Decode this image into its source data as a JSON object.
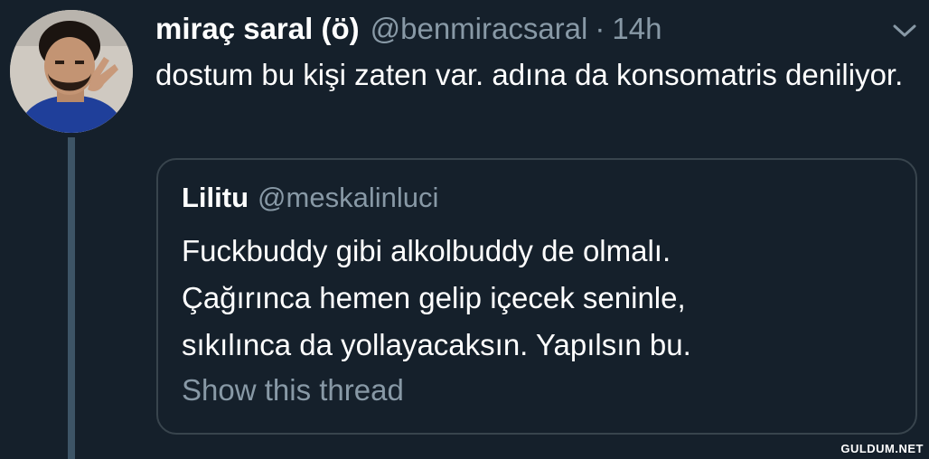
{
  "tweet": {
    "author_name": "miraç saral (ö)",
    "author_handle": "@benmiracsaral",
    "separator": "·",
    "timestamp": "14h",
    "text": "dostum bu kişi zaten var. adına da konsomatris deniliyor.",
    "menu_icon": "chevron-down-icon"
  },
  "quoted_tweet": {
    "author_name": "Lilitu",
    "author_handle": "@meskalinluci",
    "text_lines": [
      "Fuckbuddy gibi alkolbuddy de olmalı.",
      "Çağırınca hemen gelip içecek seninle,",
      "sıkılınca da yollayacaksın. Yapılsın bu."
    ],
    "show_thread_label": "Show this thread"
  },
  "watermark": "GULDUM.NET",
  "colors": {
    "background": "#15202b",
    "primary_text": "#ffffff",
    "secondary_text": "#8899a6",
    "border": "#38444d",
    "thread_line": "#3d5466"
  }
}
